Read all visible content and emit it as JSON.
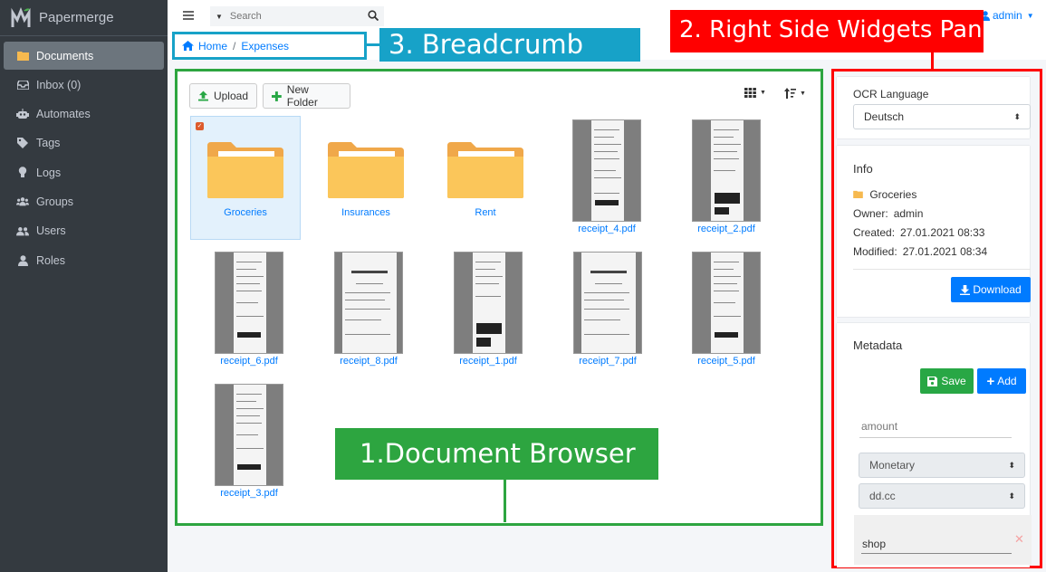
{
  "app": {
    "name": "Papermerge"
  },
  "sidebar": {
    "items": [
      {
        "label": "Documents",
        "icon": "folder-icon"
      },
      {
        "label": "Inbox (0)",
        "icon": "inbox-icon"
      },
      {
        "label": "Automates",
        "icon": "robot-icon"
      },
      {
        "label": "Tags",
        "icon": "tag-icon"
      },
      {
        "label": "Logs",
        "icon": "lightbulb-icon"
      },
      {
        "label": "Groups",
        "icon": "users-icon"
      },
      {
        "label": "Users",
        "icon": "user-friends-icon"
      },
      {
        "label": "Roles",
        "icon": "user-icon"
      }
    ]
  },
  "topbar": {
    "search_placeholder": "Search",
    "user": "admin"
  },
  "breadcrumb": {
    "home": "Home",
    "current": "Expenses"
  },
  "annotations": {
    "breadcrumb": "3. Breadcrumb",
    "right_panel": "2. Right Side Widgets Panel",
    "browser": "1.Document Browser"
  },
  "browser": {
    "upload_label": "Upload",
    "new_folder_label": "New Folder",
    "items": [
      {
        "name": "Groceries",
        "type": "folder",
        "selected": true
      },
      {
        "name": "Insurances",
        "type": "folder"
      },
      {
        "name": "Rent",
        "type": "folder"
      },
      {
        "name": "receipt_4.pdf",
        "type": "pdf"
      },
      {
        "name": "receipt_2.pdf",
        "type": "pdf"
      },
      {
        "name": "receipt_6.pdf",
        "type": "pdf"
      },
      {
        "name": "receipt_8.pdf",
        "type": "pdf"
      },
      {
        "name": "receipt_1.pdf",
        "type": "pdf"
      },
      {
        "name": "receipt_7.pdf",
        "type": "pdf"
      },
      {
        "name": "receipt_5.pdf",
        "type": "pdf"
      },
      {
        "name": "receipt_3.pdf",
        "type": "pdf"
      }
    ]
  },
  "ocr": {
    "label": "OCR Language",
    "value": "Deutsch"
  },
  "info": {
    "title": "Info",
    "folder": "Groceries",
    "owner_label": "Owner:",
    "owner": "admin",
    "created_label": "Created:",
    "created": "27.01.2021 08:33",
    "modified_label": "Modified:",
    "modified": "27.01.2021 08:34",
    "download_label": "Download"
  },
  "metadata": {
    "title": "Metadata",
    "save_label": "Save",
    "add_label": "Add",
    "key_placeholder": "amount",
    "type_value": "Monetary",
    "format_value": "dd.cc",
    "shop_value": "shop"
  },
  "colors": {
    "sidebar_bg": "#343a40",
    "link": "#007bff",
    "breadcrumb_annotation": "#17a2c8",
    "right_annotation": "#ff0000",
    "browser_annotation": "#2da540",
    "folder": "#f6b94f"
  }
}
